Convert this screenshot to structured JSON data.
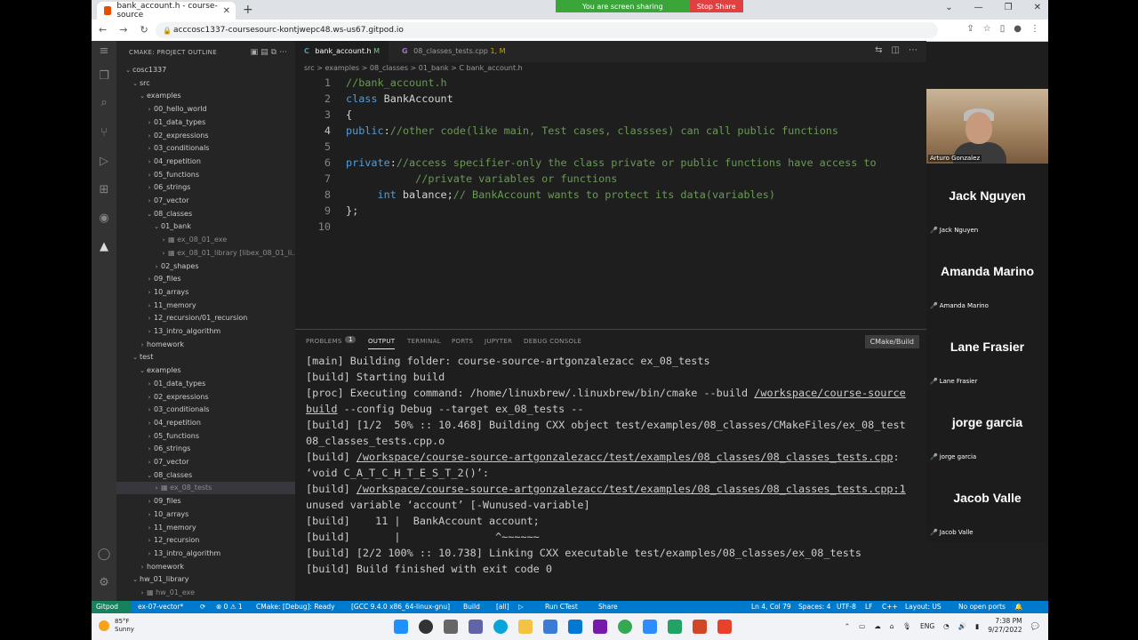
{
  "browser": {
    "tab_title": "bank_account.h - course-source",
    "url": "acccosc1337-coursesourc-kontjwepc48.ws-us67.gitpod.io",
    "share_message": "You are screen sharing",
    "stop_share_label": "Stop Share"
  },
  "sidebar": {
    "header": "CMAKE: PROJECT OUTLINE",
    "tree": [
      {
        "label": "cosc1337",
        "indent": 0,
        "chev": "v"
      },
      {
        "label": "src",
        "indent": 1,
        "chev": "v"
      },
      {
        "label": "examples",
        "indent": 2,
        "chev": "v"
      },
      {
        "label": "00_hello_world",
        "indent": 3,
        "chev": ">"
      },
      {
        "label": "01_data_types",
        "indent": 3,
        "chev": ">"
      },
      {
        "label": "02_expressions",
        "indent": 3,
        "chev": ">"
      },
      {
        "label": "03_conditionals",
        "indent": 3,
        "chev": ">"
      },
      {
        "label": "04_repetition",
        "indent": 3,
        "chev": ">"
      },
      {
        "label": "05_functions",
        "indent": 3,
        "chev": ">"
      },
      {
        "label": "06_strings",
        "indent": 3,
        "chev": ">"
      },
      {
        "label": "07_vector",
        "indent": 3,
        "chev": ">"
      },
      {
        "label": "08_classes",
        "indent": 3,
        "chev": "v"
      },
      {
        "label": "01_bank",
        "indent": 4,
        "chev": "v"
      },
      {
        "label": "ex_08_01_exe",
        "indent": 5,
        "chev": ">",
        "dim": true,
        "icon": true
      },
      {
        "label": "ex_08_01_library [libex_08_01_li...",
        "indent": 5,
        "chev": ">",
        "dim": true,
        "icon": true
      },
      {
        "label": "02_shapes",
        "indent": 4,
        "chev": ">"
      },
      {
        "label": "09_files",
        "indent": 3,
        "chev": ">"
      },
      {
        "label": "10_arrays",
        "indent": 3,
        "chev": ">"
      },
      {
        "label": "11_memory",
        "indent": 3,
        "chev": ">"
      },
      {
        "label": "12_recursion/01_recursion",
        "indent": 3,
        "chev": ">"
      },
      {
        "label": "13_intro_algorithm",
        "indent": 3,
        "chev": ">"
      },
      {
        "label": "homework",
        "indent": 2,
        "chev": ">"
      },
      {
        "label": "test",
        "indent": 1,
        "chev": "v"
      },
      {
        "label": "examples",
        "indent": 2,
        "chev": "v"
      },
      {
        "label": "01_data_types",
        "indent": 3,
        "chev": ">"
      },
      {
        "label": "02_expressions",
        "indent": 3,
        "chev": ">"
      },
      {
        "label": "03_conditionals",
        "indent": 3,
        "chev": ">"
      },
      {
        "label": "04_repetition",
        "indent": 3,
        "chev": ">"
      },
      {
        "label": "05_functions",
        "indent": 3,
        "chev": ">"
      },
      {
        "label": "06_strings",
        "indent": 3,
        "chev": ">"
      },
      {
        "label": "07_vector",
        "indent": 3,
        "chev": ">"
      },
      {
        "label": "08_classes",
        "indent": 3,
        "chev": "v"
      },
      {
        "label": "ex_08_tests",
        "indent": 4,
        "chev": ">",
        "dim": true,
        "icon": true,
        "selected": true
      },
      {
        "label": "09_files",
        "indent": 3,
        "chev": ">"
      },
      {
        "label": "10_arrays",
        "indent": 3,
        "chev": ">"
      },
      {
        "label": "11_memory",
        "indent": 3,
        "chev": ">"
      },
      {
        "label": "12_recursion",
        "indent": 3,
        "chev": ">"
      },
      {
        "label": "13_intro_algorithm",
        "indent": 3,
        "chev": ">"
      },
      {
        "label": "homework",
        "indent": 2,
        "chev": ">"
      },
      {
        "label": "hw_01_library",
        "indent": 1,
        "chev": "v"
      },
      {
        "label": "hw_01_exe",
        "indent": 2,
        "chev": ">",
        "dim": true,
        "icon": true
      }
    ]
  },
  "editor": {
    "tab_active": "bank_account.h",
    "tab_active_status": "M",
    "tab_inactive": "08_classes_tests.cpp",
    "tab_inactive_status": "1, M",
    "breadcrumb": "src > examples > 08_classes > 01_bank > C bank_account.h",
    "lines": [
      {
        "n": "1",
        "segs": [
          {
            "t": "//bank_account.h",
            "c": "#6a9955"
          }
        ]
      },
      {
        "n": "2",
        "segs": [
          {
            "t": "class ",
            "c": "#569cd6"
          },
          {
            "t": "BankAccount",
            "c": "#d4d4d4"
          }
        ]
      },
      {
        "n": "3",
        "segs": [
          {
            "t": "{",
            "c": "#d4d4d4"
          }
        ]
      },
      {
        "n": "4",
        "segs": [
          {
            "t": "public",
            "c": "#569cd6"
          },
          {
            "t": ":",
            "c": "#d4d4d4"
          },
          {
            "t": "//other code(like main, Test cases, classses) can call public functions",
            "c": "#6a9955"
          }
        ]
      },
      {
        "n": "5",
        "segs": []
      },
      {
        "n": "6",
        "segs": [
          {
            "t": "private",
            "c": "#569cd6"
          },
          {
            "t": ":",
            "c": "#d4d4d4"
          },
          {
            "t": "//access specifier-only the class private or public functions have access to",
            "c": "#6a9955"
          }
        ]
      },
      {
        "n": "7",
        "segs": [
          {
            "t": "           //private variables or functions",
            "c": "#6a9955"
          }
        ]
      },
      {
        "n": "8",
        "segs": [
          {
            "t": "     int ",
            "c": "#569cd6"
          },
          {
            "t": "balance;",
            "c": "#d4d4d4"
          },
          {
            "t": "// BankAccount wants to protect its data(variables)",
            "c": "#6a9955"
          }
        ]
      },
      {
        "n": "9",
        "segs": [
          {
            "t": "};",
            "c": "#d4d4d4"
          }
        ]
      },
      {
        "n": "10",
        "segs": []
      }
    ]
  },
  "panel": {
    "tabs": [
      "PROBLEMS",
      "OUTPUT",
      "TERMINAL",
      "PORTS",
      "JUPYTER",
      "DEBUG CONSOLE"
    ],
    "problems_count": "1",
    "selector": "CMake/Build",
    "output": [
      [
        {
          "t": "[main] Building folder: course-source-artgonzalezacc ex_08_tests"
        }
      ],
      [
        {
          "t": "[build] Starting build"
        }
      ],
      [
        {
          "t": "[proc] Executing command: /home/linuxbrew/.linuxbrew/bin/cmake --build "
        },
        {
          "t": "/workspace/course-source",
          "u": true
        }
      ],
      [
        {
          "t": "build",
          "u": true
        },
        {
          "t": " --config Debug --target ex_08_tests --"
        }
      ],
      [
        {
          "t": "[build] [1/2  50% :: 10.468] Building CXX object test/examples/08_classes/CMakeFiles/ex_08_test"
        }
      ],
      [
        {
          "t": "08_classes_tests.cpp.o"
        }
      ],
      [
        {
          "t": "[build] "
        },
        {
          "t": "/workspace/course-source-artgonzalezacc/test/examples/08_classes/08_classes_tests.cpp",
          "u": true
        },
        {
          "t": ":"
        }
      ],
      [
        {
          "t": "‘void C_A_T_C_H_T_E_S_T_2()’:"
        }
      ],
      [
        {
          "t": "[build] "
        },
        {
          "t": "/workspace/course-source-artgonzalezacc/test/examples/08_classes/08_classes_tests.cpp:1",
          "u": true
        }
      ],
      [
        {
          "t": "unused variable ‘account’ [-Wunused-variable]"
        }
      ],
      [
        {
          "t": "[build]    11 |  BankAccount account;"
        }
      ],
      [
        {
          "t": "[build]       |               ^~~~~~~"
        }
      ],
      [
        {
          "t": "[build] [2/2 100% :: 10.738] Linking CXX executable test/examples/08_classes/ex_08_tests"
        }
      ],
      [
        {
          "t": "[build] Build finished with exit code 0"
        }
      ]
    ]
  },
  "status": {
    "remote": "Gitpod",
    "branch": "ex-07-vector*",
    "problems": "⊗ 0 ⚠ 1",
    "cmake": "CMake: [Debug]: Ready",
    "kit": "[GCC 9.4.0 x86_64-linux-gnu]",
    "build": "Build",
    "target": "[all]",
    "ctest": "Run CTest",
    "share": "Share",
    "position": "Ln 4, Col 79",
    "spaces": "Spaces: 4",
    "encoding": "UTF-8",
    "eol": "LF",
    "language": "C++",
    "layout": "Layout: US",
    "ports": "No open ports"
  },
  "meeting": {
    "video_name": "Arturo Gonzalez",
    "participants": [
      "Jack Nguyen",
      "Amanda Marino",
      "Lane Frasier",
      "jorge garcia",
      "Jacob Valle"
    ]
  },
  "taskbar": {
    "temp": "85°F",
    "weather": "Sunny",
    "lang": "ENG",
    "time": "7:38 PM",
    "date": "9/27/2022"
  },
  "colors": {
    "accent": "#007acc",
    "remote": "#16825d",
    "stop_share": "#e04040",
    "share_bar": "#3aa63a"
  }
}
